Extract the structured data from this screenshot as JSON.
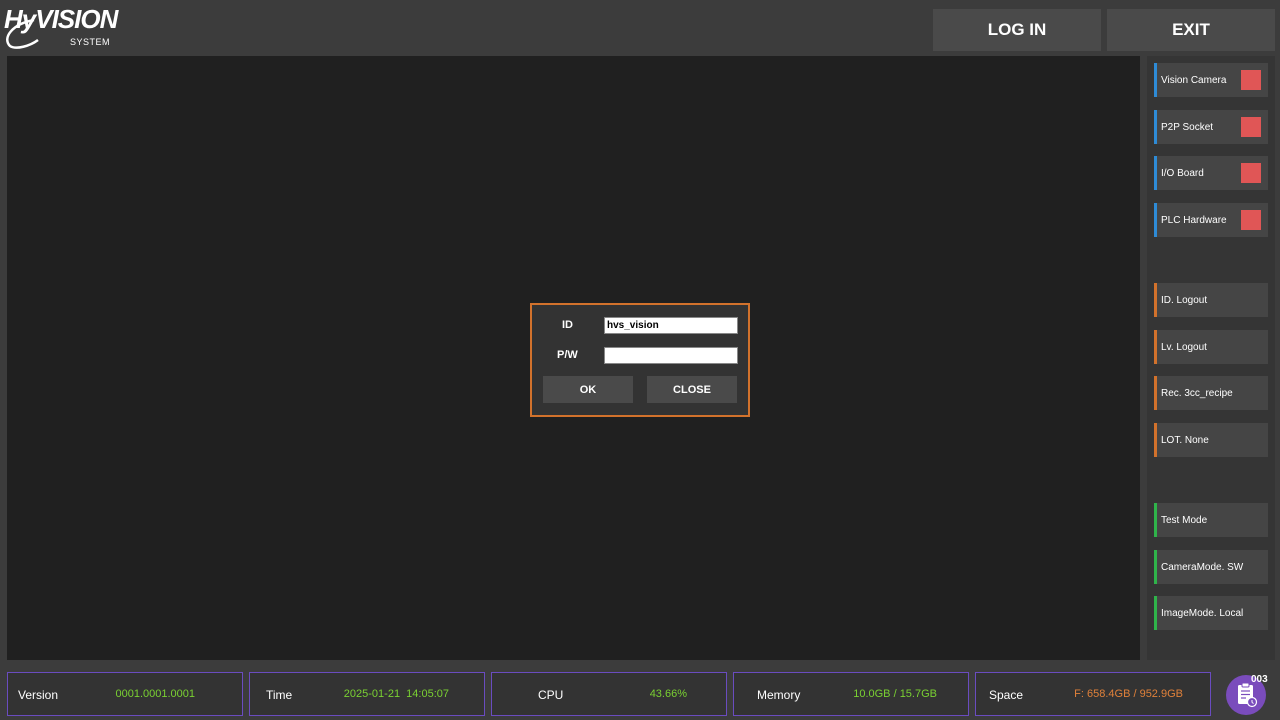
{
  "logo": {
    "main": "HyVISION",
    "sub": "SYSTEM"
  },
  "header": {
    "login_label": "LOG IN",
    "exit_label": "EXIT"
  },
  "sidebar": {
    "devices": [
      {
        "label": "Vision Camera",
        "status": "off",
        "status_color": "#e05656"
      },
      {
        "label": "P2P Socket",
        "status": "off",
        "status_color": "#e05656"
      },
      {
        "label": "I/O Board",
        "status": "off",
        "status_color": "#e05656"
      },
      {
        "label": "PLC Hardware",
        "status": "off",
        "status_color": "#e05656"
      }
    ],
    "session": [
      {
        "label": "ID. Logout"
      },
      {
        "label": "Lv. Logout"
      },
      {
        "label": "Rec. 3cc_recipe"
      },
      {
        "label": "LOT. None"
      }
    ],
    "modes": [
      {
        "label": "Test Mode"
      },
      {
        "label": "CameraMode. SW"
      },
      {
        "label": "ImageMode. Local"
      }
    ]
  },
  "dialog": {
    "id_label": "ID",
    "id_value": "hvs_vision",
    "pw_label": "P/W",
    "pw_value": "",
    "ok_label": "OK",
    "close_label": "CLOSE"
  },
  "status_bar": {
    "version": {
      "label": "Version",
      "value": "0001.0001.0001"
    },
    "time": {
      "label": "Time",
      "value": "2025-01-21  14:05:07"
    },
    "cpu": {
      "label": "CPU",
      "value": "43.66%"
    },
    "memory": {
      "label": "Memory",
      "value": "10.0GB / 15.7GB"
    },
    "space": {
      "label": "Space",
      "value": "F: 658.4GB / 952.9GB"
    }
  },
  "notification": {
    "count": "003",
    "icon": "clipboard-icon"
  },
  "colors": {
    "device_accent": "#2e8bd6",
    "session_accent": "#d2722c",
    "mode_accent": "#2fb44a",
    "status_off": "#e05656",
    "value_green": "#7ad132",
    "value_orange": "#e0813a"
  }
}
